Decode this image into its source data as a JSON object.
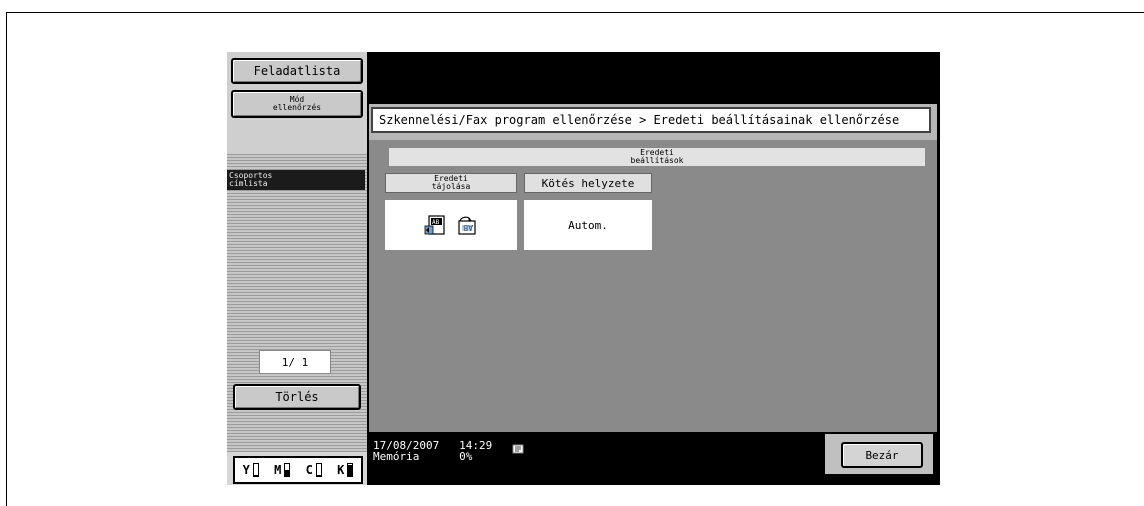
{
  "sidebar": {
    "feladatlista": "Feladatlista",
    "mod_ellenorzes": "Mód\nellenőrzés",
    "csoportos_cimlista": "Csoportos\ncímlista",
    "page_counter": "1/ 1",
    "torles": "Törlés",
    "toner": [
      {
        "label": "Y",
        "level": 0.1
      },
      {
        "label": "M",
        "level": 0.5
      },
      {
        "label": "C",
        "level": 0.1
      },
      {
        "label": "K",
        "level": 0.9
      }
    ]
  },
  "main": {
    "breadcrumb": "Szkennelési/Fax program ellenőrzése > Eredeti beállításainak ellenőrzése",
    "group_header": "Eredeti\nbeállítások",
    "columns": [
      "Eredeti\ntájolása",
      "Kötés helyzete"
    ],
    "values": {
      "orientation_icons": [
        "orientation-rotate-left-icon",
        "orientation-rotate-right-icon"
      ],
      "binding": "Autom."
    }
  },
  "footer": {
    "date_time": "17/08/2007   14:29",
    "memory": "Memória      0%",
    "status_icon": "paper-jam-icon",
    "close": "Bezár"
  }
}
